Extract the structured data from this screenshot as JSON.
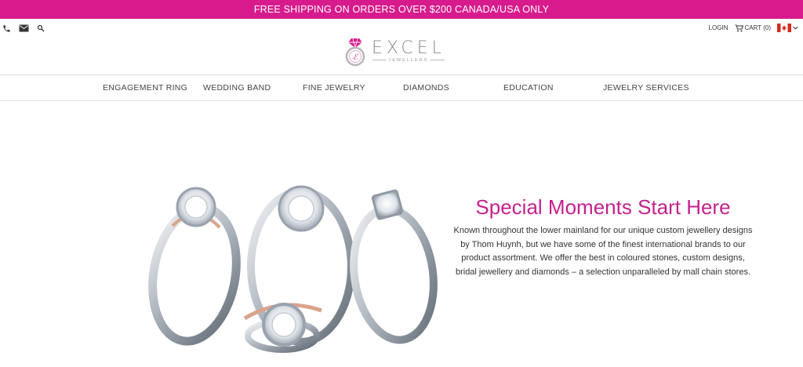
{
  "promo": {
    "text": "FREE SHIPPING ON ORDERS OVER $200 CANADA/USA ONLY"
  },
  "utility": {
    "left_icons": [
      "phone-icon",
      "mail-icon",
      "search-icon"
    ],
    "login_label": "LOGIN",
    "cart_label": "CART (0)",
    "flag": "canada-flag-icon",
    "chevron": "chevron-down-icon"
  },
  "logo": {
    "name": "EXCEL",
    "subtitle": "JEWELLERS"
  },
  "nav": {
    "items": [
      {
        "label": "ENGAGEMENT RING"
      },
      {
        "label": "WEDDING BAND"
      },
      {
        "label": "FINE JEWELRY"
      },
      {
        "label": "DIAMONDS"
      },
      {
        "label": "EDUCATION"
      },
      {
        "label": "JEWELRY SERVICES"
      }
    ]
  },
  "hero": {
    "title": "Special Moments Start Here",
    "body": "Known throughout the lower mainland for our unique custom jewellery designs by Thom Huynh, but we have some of the finest international brands to our product assortment. We offer the best in coloured stones, custom designs, bridal jewellery and diamonds – a selection unparalleled by mall chain stores."
  },
  "colors": {
    "brand_pink": "#d81b8c",
    "title_magenta": "#c4228d"
  }
}
